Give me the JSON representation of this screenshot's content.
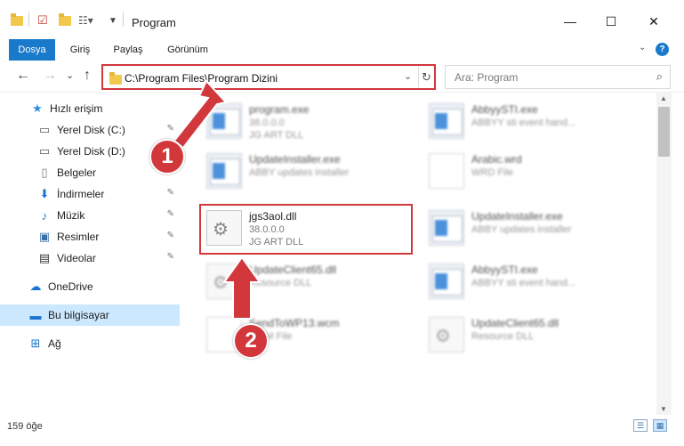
{
  "window": {
    "title": "Program",
    "minimize_glyph": "—",
    "maximize_glyph": "☐",
    "close_glyph": "✕"
  },
  "ribbon": {
    "tabs": [
      {
        "label": "Dosya",
        "active": true
      },
      {
        "label": "Giriş",
        "active": false
      },
      {
        "label": "Paylaş",
        "active": false
      },
      {
        "label": "Görünüm",
        "active": false
      }
    ],
    "help_glyph": "?"
  },
  "nav": {
    "back": "←",
    "forward": "→",
    "recent": "⌄",
    "up": "↑",
    "address": "C:\\Program Files\\Program Dizini",
    "search_placeholder": "Ara: Program"
  },
  "sidebar": {
    "items": [
      {
        "label": "Hızlı erişim",
        "icon": "star-icon",
        "glyph": "★",
        "color": "#2d8ee0",
        "pinned": false
      },
      {
        "label": "Yerel Disk (C:)",
        "icon": "drive-icon",
        "glyph": "▭",
        "color": "#5a5a5a",
        "pinned": true
      },
      {
        "label": "Yerel Disk (D:)",
        "icon": "drive-icon",
        "glyph": "▭",
        "color": "#5a5a5a",
        "pinned": true
      },
      {
        "label": "Belgeler",
        "icon": "document-icon",
        "glyph": "▯",
        "color": "#7a7a7a",
        "pinned": true
      },
      {
        "label": "İndirmeler",
        "icon": "download-icon",
        "glyph": "⬇",
        "color": "#1a73d2",
        "pinned": true
      },
      {
        "label": "Müzik",
        "icon": "music-icon",
        "glyph": "♪",
        "color": "#1a73d2",
        "pinned": true
      },
      {
        "label": "Resimler",
        "icon": "pictures-icon",
        "glyph": "▣",
        "color": "#3a6fa8",
        "pinned": true
      },
      {
        "label": "Videolar",
        "icon": "video-icon",
        "glyph": "▤",
        "color": "#3a3a3a",
        "pinned": true
      },
      {
        "label": "OneDrive",
        "icon": "cloud-icon",
        "glyph": "☁",
        "color": "#1a73d2",
        "pinned": false
      },
      {
        "label": "Bu bilgisayar",
        "icon": "computer-icon",
        "glyph": "▬",
        "color": "#1a73d2",
        "pinned": false,
        "selected": true
      },
      {
        "label": "Ağ",
        "icon": "network-icon",
        "glyph": "⊞",
        "color": "#1a73d2",
        "pinned": false
      }
    ],
    "pin_glyph": "📌"
  },
  "files": [
    {
      "name": "program.exe",
      "line2": "38.0.0.0",
      "line3": "JG ART DLL",
      "kind": "exe"
    },
    {
      "name": "AbbyySTI.exe",
      "line2": "ABBYY sti event hand...",
      "line3": "",
      "kind": "exe"
    },
    {
      "name": "UpdateInstaller.exe",
      "line2": "ABBY updates installer",
      "line3": "",
      "kind": "exe"
    },
    {
      "name": "Arabic.wrd",
      "line2": "WRD File",
      "line3": "",
      "kind": "doc"
    },
    {
      "name": "jgs3aol.dll",
      "line2": "38.0.0.0",
      "line3": "JG ART DLL",
      "kind": "dll",
      "highlighted": true
    },
    {
      "name": "UpdateInstaller.exe",
      "line2": "ABBY updates installer",
      "line3": "",
      "kind": "exe"
    },
    {
      "name": "UpdateClient65.dll",
      "line2": "Resource DLL",
      "line3": "",
      "kind": "dll"
    },
    {
      "name": "AbbyySTI.exe",
      "line2": "ABBYY sti event hand...",
      "line3": "",
      "kind": "exe"
    },
    {
      "name": "SendToWP13.wcm",
      "line2": "WCM File",
      "line3": "",
      "kind": "doc"
    },
    {
      "name": "UpdateClient65.dll",
      "line2": "Resource DLL",
      "line3": "",
      "kind": "dll"
    }
  ],
  "status": {
    "item_count": "159 öğe"
  },
  "annotations": {
    "badge1": "1",
    "badge2": "2",
    "accent": "#d2373c"
  }
}
